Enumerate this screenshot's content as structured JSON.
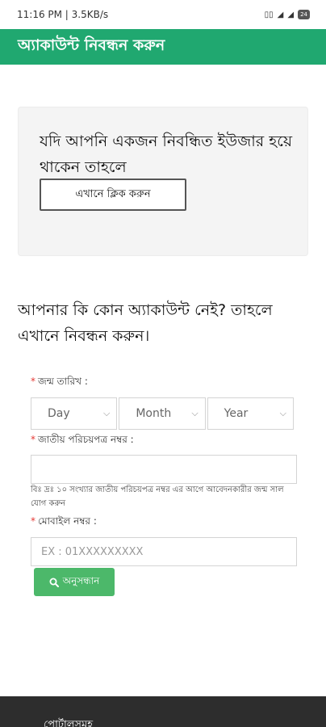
{
  "status_bar": {
    "time_speed": "11:16 PM | 3.5KB/s",
    "battery": "24"
  },
  "app_bar": {
    "title": "অ্যাকাউন্ট নিবন্ধন করুন"
  },
  "login_card": {
    "text": "যদি আপনি একজন নিবন্ধিত ইউজার হয়ে থাকেন তাহলে",
    "button_label": "এখানে ক্লিক করুন"
  },
  "register": {
    "heading": "আপনার কি কোন অ্যাকাউন্ট নেই? তাহলে এখানে নিবন্ধন করুন।"
  },
  "form": {
    "required_mark": "*",
    "dob_label": "জন্ম তারিখ :",
    "day": "Day",
    "month": "Month",
    "year": "Year",
    "nid_label": "জাতীয় পরিচয়পত্র নম্বর :",
    "nid_value": "",
    "note": "বিঃ দ্রঃ ১০ সংখ্যার জাতীয় পরিচয়পত্র নম্বর এর আগে আবেদনকারীর জন্ম সাল যোগ করুন",
    "mobile_label": "মোবাইল নম্বর :",
    "mobile_placeholder": "EX : 01XXXXXXXXX",
    "search_label": "অনুসন্ধান"
  },
  "footer": {
    "text": "পোর্টালসমূহ"
  },
  "colors": {
    "app_bar": "#20a870",
    "search_button": "#4cb86a",
    "required": "#e53935",
    "footer": "#2d2d2d"
  }
}
